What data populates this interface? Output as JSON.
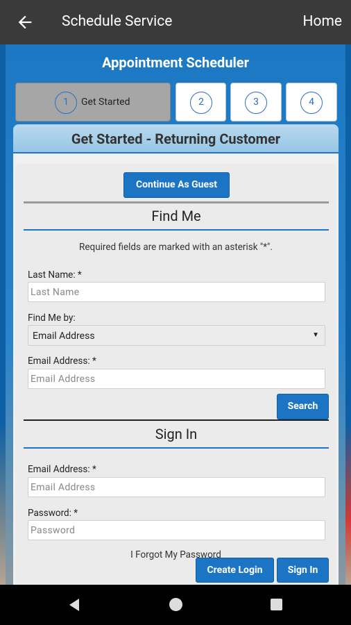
{
  "appbar": {
    "title": "Schedule Service",
    "home_label": "Home"
  },
  "heading": "Appointment Scheduler",
  "steps": [
    {
      "number": "1",
      "label": "Get Started",
      "active": true
    },
    {
      "number": "2"
    },
    {
      "number": "3"
    },
    {
      "number": "4"
    }
  ],
  "panel": {
    "title": "Get Started - Returning Customer",
    "guest_button": "Continue As Guest",
    "find_me": {
      "title": "Find Me",
      "required_note": "Required fields are marked with an asterisk \"*\".",
      "last_name_label": "Last Name: *",
      "last_name_placeholder": "Last Name",
      "find_by_label": "Find Me by:",
      "find_by_value": "Email Address",
      "email_label": "Email Address: *",
      "email_placeholder": "Email Address",
      "search_button": "Search"
    },
    "sign_in": {
      "title": "Sign In",
      "email_label": "Email Address: *",
      "email_placeholder": "Email Address",
      "password_label": "Password: *",
      "password_placeholder": "Password",
      "forgot_link": "I Forgot My Password",
      "create_login_button": "Create Login",
      "sign_in_button": "Sign In"
    }
  },
  "colors": {
    "accent": "#1b74c4",
    "appbar": "#3a3a3a"
  }
}
